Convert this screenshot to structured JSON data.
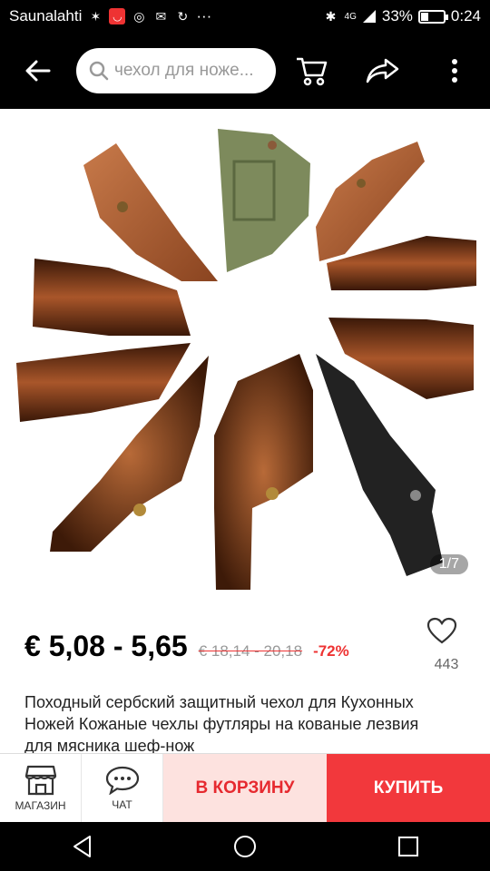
{
  "status_bar": {
    "carrier": "Saunalahti",
    "more": "···",
    "network": "4G",
    "battery_pct": "33%",
    "battery_level": 0.33,
    "time": "0:24"
  },
  "top_bar": {
    "search_text": "чехол для ноже..."
  },
  "product": {
    "image_counter": "1/7",
    "price": "€ 5,08 - 5,65",
    "old_price": "€ 18,14 - 20,18",
    "discount": "-72%",
    "wish_count": "443",
    "title": "Походный сербский защитный чехол для Кухонных Ножей Кожаные чехлы футляры на кованые лезвия для мясника шеф-нож"
  },
  "bottom_bar": {
    "store_label": "МАГАЗИН",
    "chat_label": "ЧАТ",
    "cart_label": "В КОРЗИНУ",
    "buy_label": "КУПИТЬ"
  },
  "colors": {
    "accent": "#f2383c",
    "cart_bg": "#fde2df",
    "leather": "#7a3a1a"
  }
}
